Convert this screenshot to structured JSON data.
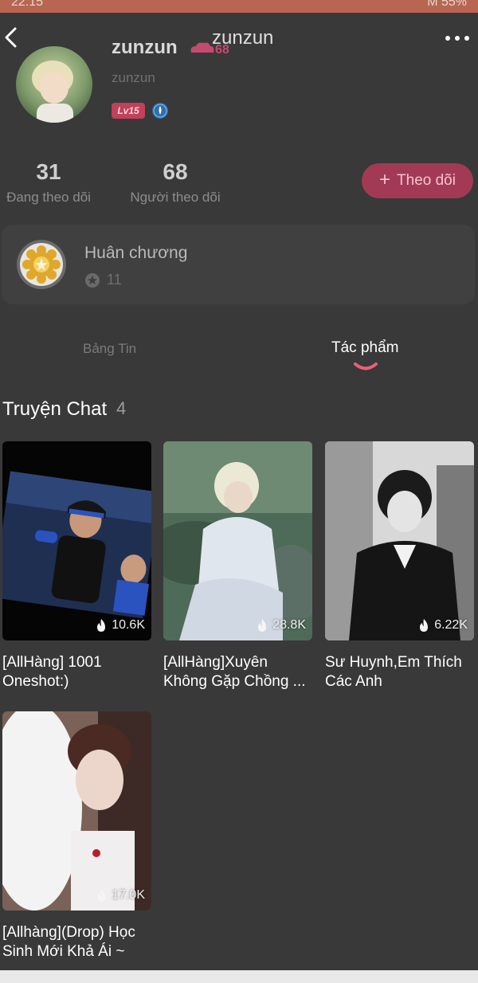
{
  "status_bar": {
    "time": "22:15",
    "right": "M 55%"
  },
  "profile": {
    "name": "zunzun",
    "name_overlay": "zunzun",
    "badge_number": "68",
    "id": "zunzun",
    "level": "Lv15"
  },
  "stats": [
    {
      "value": "31",
      "label": "Đang theo dõi"
    },
    {
      "value": "68",
      "label": "Người theo dõi"
    }
  ],
  "follow_button": {
    "plus": "+",
    "label": "Theo dõi"
  },
  "medals": {
    "title": "Huân chương",
    "count": "11"
  },
  "tabs": [
    {
      "label": "Bảng Tin",
      "active": false
    },
    {
      "label": "Tác phẩm",
      "active": true
    }
  ],
  "section": {
    "title": "Truyện Chat",
    "count": "4"
  },
  "stories": [
    {
      "line1": "[AllHàng] 1001",
      "line2": "Oneshot:)",
      "views": "10.6K"
    },
    {
      "line1": "[AllHàng]Xuyên",
      "line2": "Không Gặp Chồng ...",
      "views": "28.8K"
    },
    {
      "line1": "Sư Huynh,Em Thích",
      "line2": "Các Anh",
      "views": "6.22K"
    },
    {
      "line1": "[Allhàng](Drop) Học",
      "line2": "Sinh Mới Khả Ái ~",
      "views": "17.0K"
    }
  ],
  "colors": {
    "background": "#393939",
    "accent": "#a23a55",
    "level_badge": "#c1405a",
    "tab_indicator": "#e8607a"
  },
  "icons": {
    "back": "chevron-left-icon",
    "more": "more-dots-icon",
    "verify": "verified-badge-icon",
    "medal": "medal-icon",
    "views": "flame-icon"
  }
}
